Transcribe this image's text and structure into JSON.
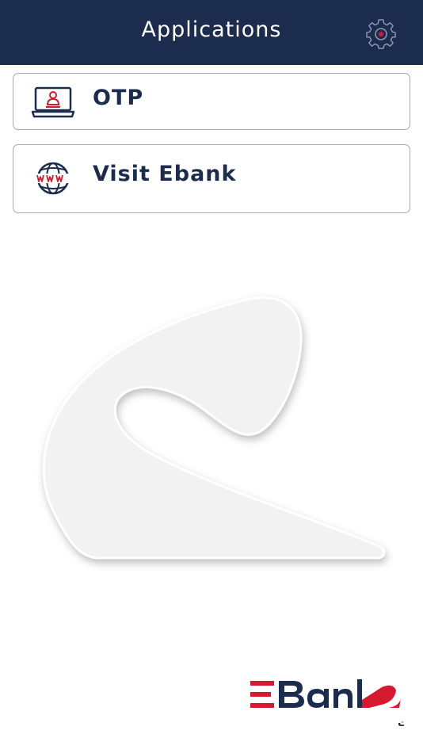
{
  "header": {
    "title": "Applications",
    "settings_icon": "gear-icon"
  },
  "apps": [
    {
      "label": "OTP",
      "icon": "laptop-user-icon"
    },
    {
      "label": "Visit Ebank",
      "icon": "globe-www-icon"
    }
  ],
  "brand": {
    "name": "EBank",
    "tagline": "البنك المصري لتنمية الصادرات",
    "watermark_icon": "ebank-swoosh-icon",
    "primary_color": "#1c2c4f",
    "accent_color": "#d7192f"
  }
}
